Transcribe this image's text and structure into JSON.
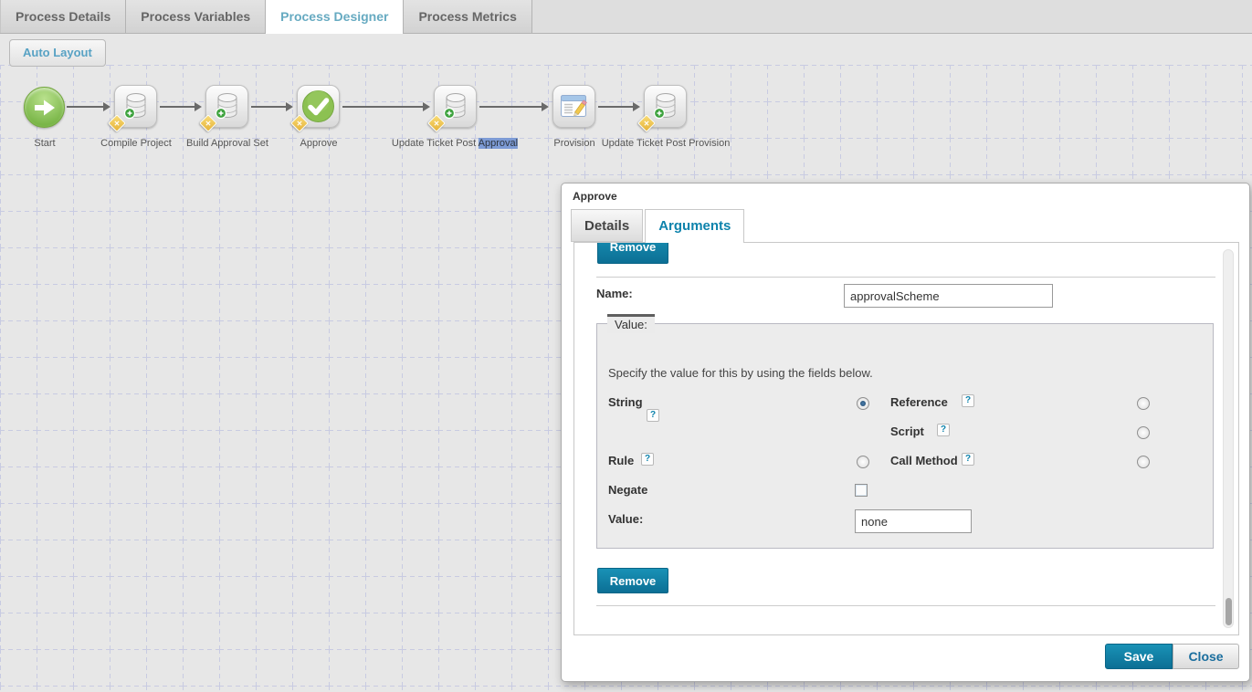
{
  "top_tabs": [
    {
      "label": "Process Details",
      "active": false
    },
    {
      "label": "Process Variables",
      "active": false
    },
    {
      "label": "Process Designer",
      "active": true
    },
    {
      "label": "Process Metrics",
      "active": false
    }
  ],
  "toolbar": {
    "auto_layout_label": "Auto Layout"
  },
  "workflow": {
    "nodes": [
      {
        "label": "Start",
        "type": "start"
      },
      {
        "label": "Compile Project",
        "type": "task"
      },
      {
        "label": "Build Approval Set",
        "type": "task"
      },
      {
        "label": "Approve",
        "type": "approval"
      },
      {
        "label_prefix": "Update Ticket Post ",
        "label_selected": "Approval",
        "type": "task"
      },
      {
        "label": "Provision",
        "type": "provision"
      },
      {
        "label": "Update Ticket Post Provision",
        "type": "task"
      }
    ]
  },
  "dialog": {
    "title": "Approve",
    "tabs": [
      {
        "label": "Details",
        "active": false
      },
      {
        "label": "Arguments",
        "active": true
      }
    ],
    "arguments_panel": {
      "remove_top_label": "Remove",
      "name_label": "Name:",
      "name_value": "approvalScheme",
      "value_group": {
        "legend": "Value:",
        "instructions": "Specify the value for this by using the fields below.",
        "help_glyph": "?",
        "options": {
          "string": "String",
          "reference": "Reference",
          "script": "Script",
          "rule": "Rule",
          "call_method": "Call Method"
        },
        "selected_option": "String",
        "negate_label": "Negate",
        "negate_checked": false,
        "value_label": "Value:",
        "value_value": "none"
      },
      "remove_bottom_label": "Remove"
    },
    "footer": {
      "save_label": "Save",
      "close_label": "Close"
    }
  },
  "colors": {
    "accent_teal_button": "#0e83ac",
    "active_tab_text": "#66aac1",
    "selection_highlight": "#7d9bd5",
    "grid_line": "#c8cbe2"
  }
}
